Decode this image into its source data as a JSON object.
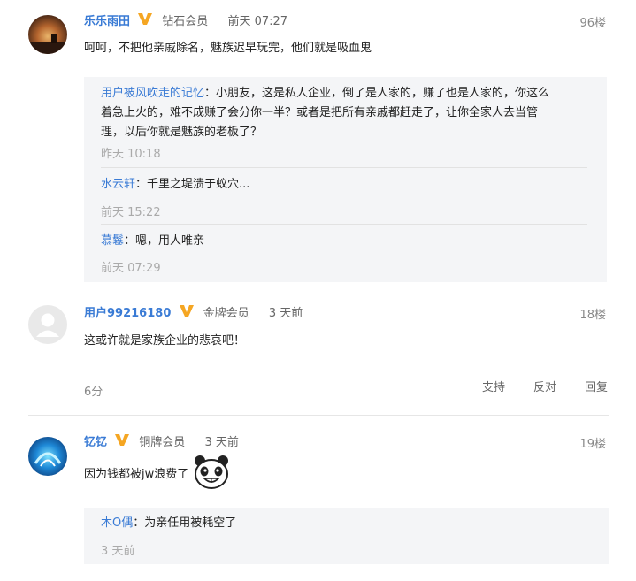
{
  "comments": [
    {
      "username": "乐乐雨田",
      "level": "钻石会员",
      "time": "前天 07:27",
      "floor": "96楼",
      "text": "呵呵，不把他亲戚除名，魅族迟早玩完，他们就是吸血鬼",
      "replies": [
        {
          "name": "用户被风吹走的记忆",
          "sep": "：",
          "text": "小朋友，这是私人企业，倒了是人家的，赚了也是人家的，你这么",
          "text2": "着急上火的，难不成赚了会分你一半？或者是把所有亲戚都赶走了，让你全家人去当管",
          "text3": "理，以后你就是魅族的老板了？",
          "time": "昨天 10:18"
        },
        {
          "name": "水云轩",
          "sep": "：",
          "text": "千里之堤溃于蚁穴...",
          "time": "前天 15:22"
        },
        {
          "name": "慕鬈",
          "sep": "：",
          "text": "嗯，用人唯亲",
          "time": "前天 07:29"
        }
      ]
    },
    {
      "username": "用户99216180",
      "level": "金牌会员",
      "time": "3 天前",
      "floor": "18楼",
      "text": "这或许就是家族企业的悲哀吧！",
      "score": "6分",
      "actions": {
        "support": "支持",
        "oppose": "反对",
        "reply": "回复"
      }
    },
    {
      "username": "钇钇",
      "level": "铜牌会员",
      "time": "3 天前",
      "floor": "19楼",
      "text": "因为钱都被jw浪费了",
      "replies": [
        {
          "name": "木O偶",
          "sep": "：",
          "text": "为亲任用被耗空了",
          "time": "3 天前"
        }
      ]
    }
  ],
  "colors": {
    "link": "#3a7bd5",
    "badge": "#f5a623",
    "reply_bg": "#f4f5f7"
  },
  "icons": [
    "v-badge-icon",
    "panda-emoji-icon",
    "default-avatar-icon"
  ]
}
